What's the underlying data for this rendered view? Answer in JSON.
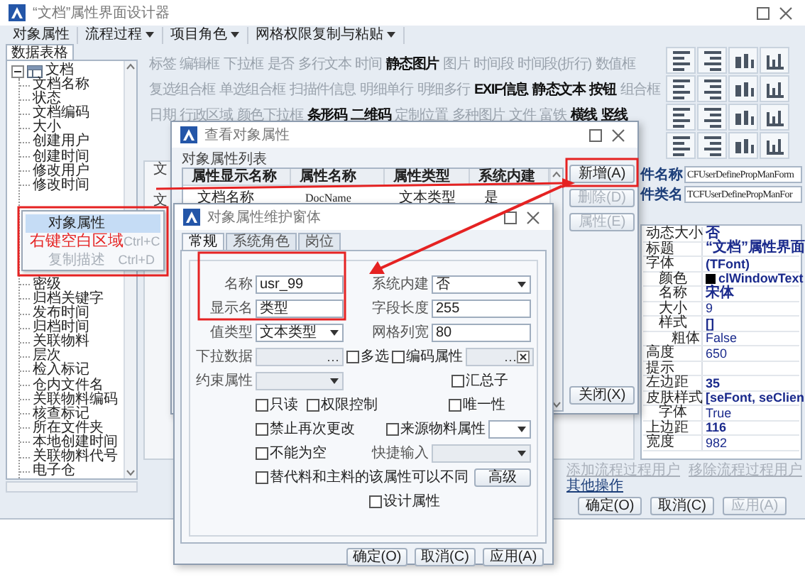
{
  "window": {
    "title": "“文档”属性界面设计器"
  },
  "toolbar": [
    {
      "label": "对象属性",
      "dropdown": false
    },
    {
      "label": "流程过程",
      "dropdown": true
    },
    {
      "label": "项目角色",
      "dropdown": true
    },
    {
      "label": "网格权限复制与粘贴",
      "dropdown": true
    }
  ],
  "data_panel": {
    "tab": "数据表格",
    "tree": [
      {
        "kind": "node",
        "label": "文档",
        "expanded": true,
        "children": [
          {
            "kind": "node",
            "label": "文档名称"
          },
          {
            "kind": "node",
            "label": "状态"
          },
          {
            "kind": "node",
            "label": "文档编码"
          },
          {
            "kind": "node",
            "label": "大小"
          },
          {
            "kind": "node",
            "label": "创建用户"
          },
          {
            "kind": "node",
            "label": "创建时间"
          },
          {
            "kind": "node",
            "label": "修改用户"
          },
          {
            "kind": "node",
            "label": "修改时间"
          },
          {
            "kind": "covered"
          },
          {
            "kind": "node",
            "label": "密级"
          },
          {
            "kind": "node",
            "label": "归档关键字"
          },
          {
            "kind": "node",
            "label": "发布时间"
          },
          {
            "kind": "node",
            "label": "归档时间"
          },
          {
            "kind": "node",
            "label": "关联物料"
          },
          {
            "kind": "node",
            "label": "层次"
          },
          {
            "kind": "node",
            "label": "检入标记"
          },
          {
            "kind": "node",
            "label": "仓内文件名"
          },
          {
            "kind": "node",
            "label": "关联物料编码"
          },
          {
            "kind": "node",
            "label": "核查标记"
          },
          {
            "kind": "node",
            "label": "所在文件夹"
          },
          {
            "kind": "node",
            "label": "本地创建时间"
          },
          {
            "kind": "node",
            "label": "关联物料代号"
          },
          {
            "kind": "node",
            "label": "电子仓"
          }
        ]
      }
    ]
  },
  "context_menu": {
    "items": [
      {
        "label": "对象属性",
        "selected": true,
        "disabled": false
      },
      {
        "shortcut": "Ctrl+C",
        "selected": false,
        "disabled": true
      },
      {
        "label": "复制描述",
        "shortcut": "Ctrl+D",
        "selected": false,
        "disabled": true
      }
    ],
    "note": "右键空白区域"
  },
  "palette": [
    {
      "items": [
        {
          "label": "标签",
          "enabled": false
        },
        {
          "label": "编辑框",
          "enabled": false
        },
        {
          "label": "下拉框",
          "enabled": false
        },
        {
          "label": "是否",
          "enabled": false
        },
        {
          "label": "多行文本",
          "enabled": false
        },
        {
          "label": "时间",
          "enabled": false
        },
        {
          "label": "静态图片",
          "enabled": true
        },
        {
          "label": "图片",
          "enabled": false
        },
        {
          "label": "时间段",
          "enabled": false
        },
        {
          "label": "时间段(折行)",
          "enabled": false
        },
        {
          "label": "数值框",
          "enabled": false
        }
      ]
    },
    {
      "items": [
        {
          "label": "复选组合框",
          "enabled": false
        },
        {
          "label": "单选组合框",
          "enabled": false
        },
        {
          "label": "扫描件信息",
          "enabled": false
        },
        {
          "label": "明细单行",
          "enabled": false
        },
        {
          "label": "明细多行",
          "enabled": false
        },
        {
          "label": "EXIF信息",
          "enabled": true
        },
        {
          "label": "静态文本",
          "enabled": true
        },
        {
          "label": "按钮",
          "enabled": true
        },
        {
          "label": "组合框",
          "enabled": false
        }
      ]
    },
    {
      "items": [
        {
          "label": "日期",
          "enabled": false
        },
        {
          "label": "行政区域",
          "enabled": false
        },
        {
          "label": "颜色下拉框",
          "enabled": false
        },
        {
          "label": "条形码",
          "enabled": true
        },
        {
          "label": "二维码",
          "enabled": true
        },
        {
          "label": "定制位置",
          "enabled": false
        },
        {
          "label": "多种图片",
          "enabled": false
        },
        {
          "label": "文件",
          "enabled": false
        },
        {
          "label": "富铁",
          "enabled": false
        },
        {
          "label": "横线",
          "enabled": true
        },
        {
          "label": "竖线",
          "enabled": true
        }
      ]
    }
  ],
  "canvas": {
    "labels": [
      "文",
      "文"
    ]
  },
  "component": {
    "name_label": "件名称",
    "name": "CFUserDefinePropManForm",
    "class_label": "件类名",
    "class": "TCFUserDefinePropManFor"
  },
  "properties": [
    {
      "name": "动态大小",
      "value": "否",
      "modified": true
    },
    {
      "name": "标题",
      "value": "“文档”属性界面",
      "modified": true
    },
    {
      "name": "字体",
      "value": "(TFont)",
      "modified": true,
      "children": [
        {
          "name": "颜色",
          "value": "clWindowText",
          "color": "#000000",
          "modified": true
        },
        {
          "name": "名称",
          "value": "宋体",
          "modified": true
        },
        {
          "name": "大小",
          "value": "9",
          "modified": false
        },
        {
          "name": "样式",
          "value": "[]",
          "modified": true,
          "children": [
            {
              "name": "粗体",
              "value": "False",
              "modified": false
            }
          ]
        }
      ]
    },
    {
      "name": "高度",
      "value": "650",
      "modified": false
    },
    {
      "name": "提示"
    },
    {
      "name": "左边距",
      "value": "35",
      "modified": true
    },
    {
      "name": "皮肤样式",
      "value": "[seFont, seClien",
      "modified": true,
      "children": [
        {
          "name": "字体",
          "value": "True",
          "modified": false
        }
      ]
    },
    {
      "name": "上边距",
      "value": "116",
      "modified": true
    },
    {
      "name": "宽度",
      "value": "982",
      "modified": false
    }
  ],
  "process_links": [
    {
      "label": "添加流程过程用户",
      "disabled": true
    },
    {
      "label": "移除流程过程用户",
      "disabled": true
    }
  ],
  "other_actions": "其他操作",
  "buttons": [
    {
      "label": "确定(O)",
      "disabled": false
    },
    {
      "label": "取消(C)",
      "disabled": false
    },
    {
      "label": "应用(A)",
      "disabled": true
    }
  ],
  "list_dialog": {
    "title": "查看对象属性",
    "list_label": "对象属性列表",
    "columns": [
      "属性显示名称",
      "属性名称",
      "属性类型",
      "系统内建"
    ],
    "rows": [
      [
        "文档名称",
        "DocName",
        "文本类型",
        "是"
      ]
    ],
    "buttons": [
      {
        "label": "新增(A)",
        "disabled": false
      },
      {
        "label": "删除(D)",
        "disabled": true
      },
      {
        "label": "属性(E)",
        "disabled": true
      }
    ],
    "close_button": "关闭(X)"
  },
  "edit_dialog": {
    "title": "对象属性维护窗体",
    "tabs": [
      {
        "label": "常规",
        "selected": true
      },
      {
        "label": "系统角色",
        "selected": false
      },
      {
        "label": "岗位",
        "selected": false
      }
    ],
    "name": {
      "label": "名称",
      "value": "usr_99"
    },
    "display_name": {
      "label": "显示名",
      "value": "类型"
    },
    "value_type": {
      "label": "值类型",
      "value": "文本类型"
    },
    "dropdown_data": {
      "label": "下拉数据",
      "disabled": true
    },
    "constraint": {
      "label": "约束属性",
      "disabled": true
    },
    "system_builtin": {
      "label": "系统内建",
      "value": "否"
    },
    "field_length": {
      "label": "字段长度",
      "value": "255"
    },
    "grid_width": {
      "label": "网格列宽",
      "value": "80"
    },
    "multi_select": {
      "label": "多选",
      "checked": false
    },
    "encoded": {
      "label": "编码属性",
      "checked": false
    },
    "code_field": {
      "disabled": true
    },
    "summary": {
      "label": "汇总子",
      "checked": false
    },
    "read_only": {
      "label": "只读",
      "checked": false
    },
    "permission": {
      "label": "权限控制",
      "checked": false
    },
    "unique": {
      "label": "唯一性",
      "checked": false
    },
    "no_rechange": {
      "label": "禁止再次更改",
      "checked": false
    },
    "source_material": {
      "label": "来源物料属性",
      "checked": false
    },
    "not_empty": {
      "label": "不能为空",
      "checked": false
    },
    "quick_input": {
      "label": "快捷输入",
      "disabled": true
    },
    "substitute": {
      "label": "替代料和主料的该属性可以不同",
      "checked": false
    },
    "design": {
      "label": "设计属性",
      "checked": false
    },
    "advanced_button": "高级",
    "buttons": [
      {
        "label": "确定(O)",
        "disabled": false
      },
      {
        "label": "取消(C)",
        "disabled": false
      },
      {
        "label": "应用(A)",
        "disabled": false
      }
    ]
  }
}
